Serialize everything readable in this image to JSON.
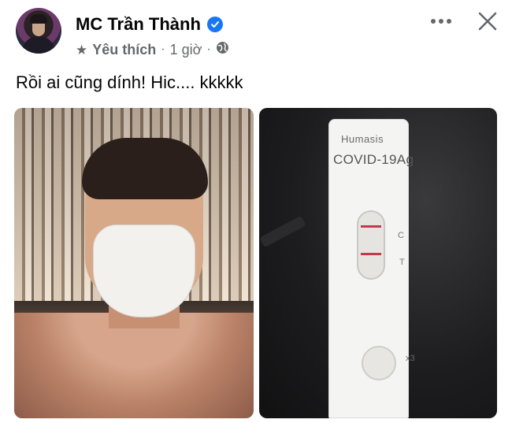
{
  "post": {
    "author": "MC Trần Thành",
    "verified_icon": "verified-badge-icon",
    "audience_label": "Yêu thích",
    "time": "1 giờ",
    "separator": "·",
    "text": "Rồi ai cũng dính! Hic.... kkkkk"
  },
  "photos": [
    {
      "description_icon": "selfie-photo",
      "label": ""
    },
    {
      "test_kit": {
        "brand": "Humasis",
        "product": "COVID-19Ag",
        "control_label": "C",
        "test_label": "T",
        "sample_label": "x3"
      }
    }
  ],
  "colors": {
    "verified": "#1877f2",
    "meta_text": "#65676b",
    "test_line": "#c23b4c"
  }
}
